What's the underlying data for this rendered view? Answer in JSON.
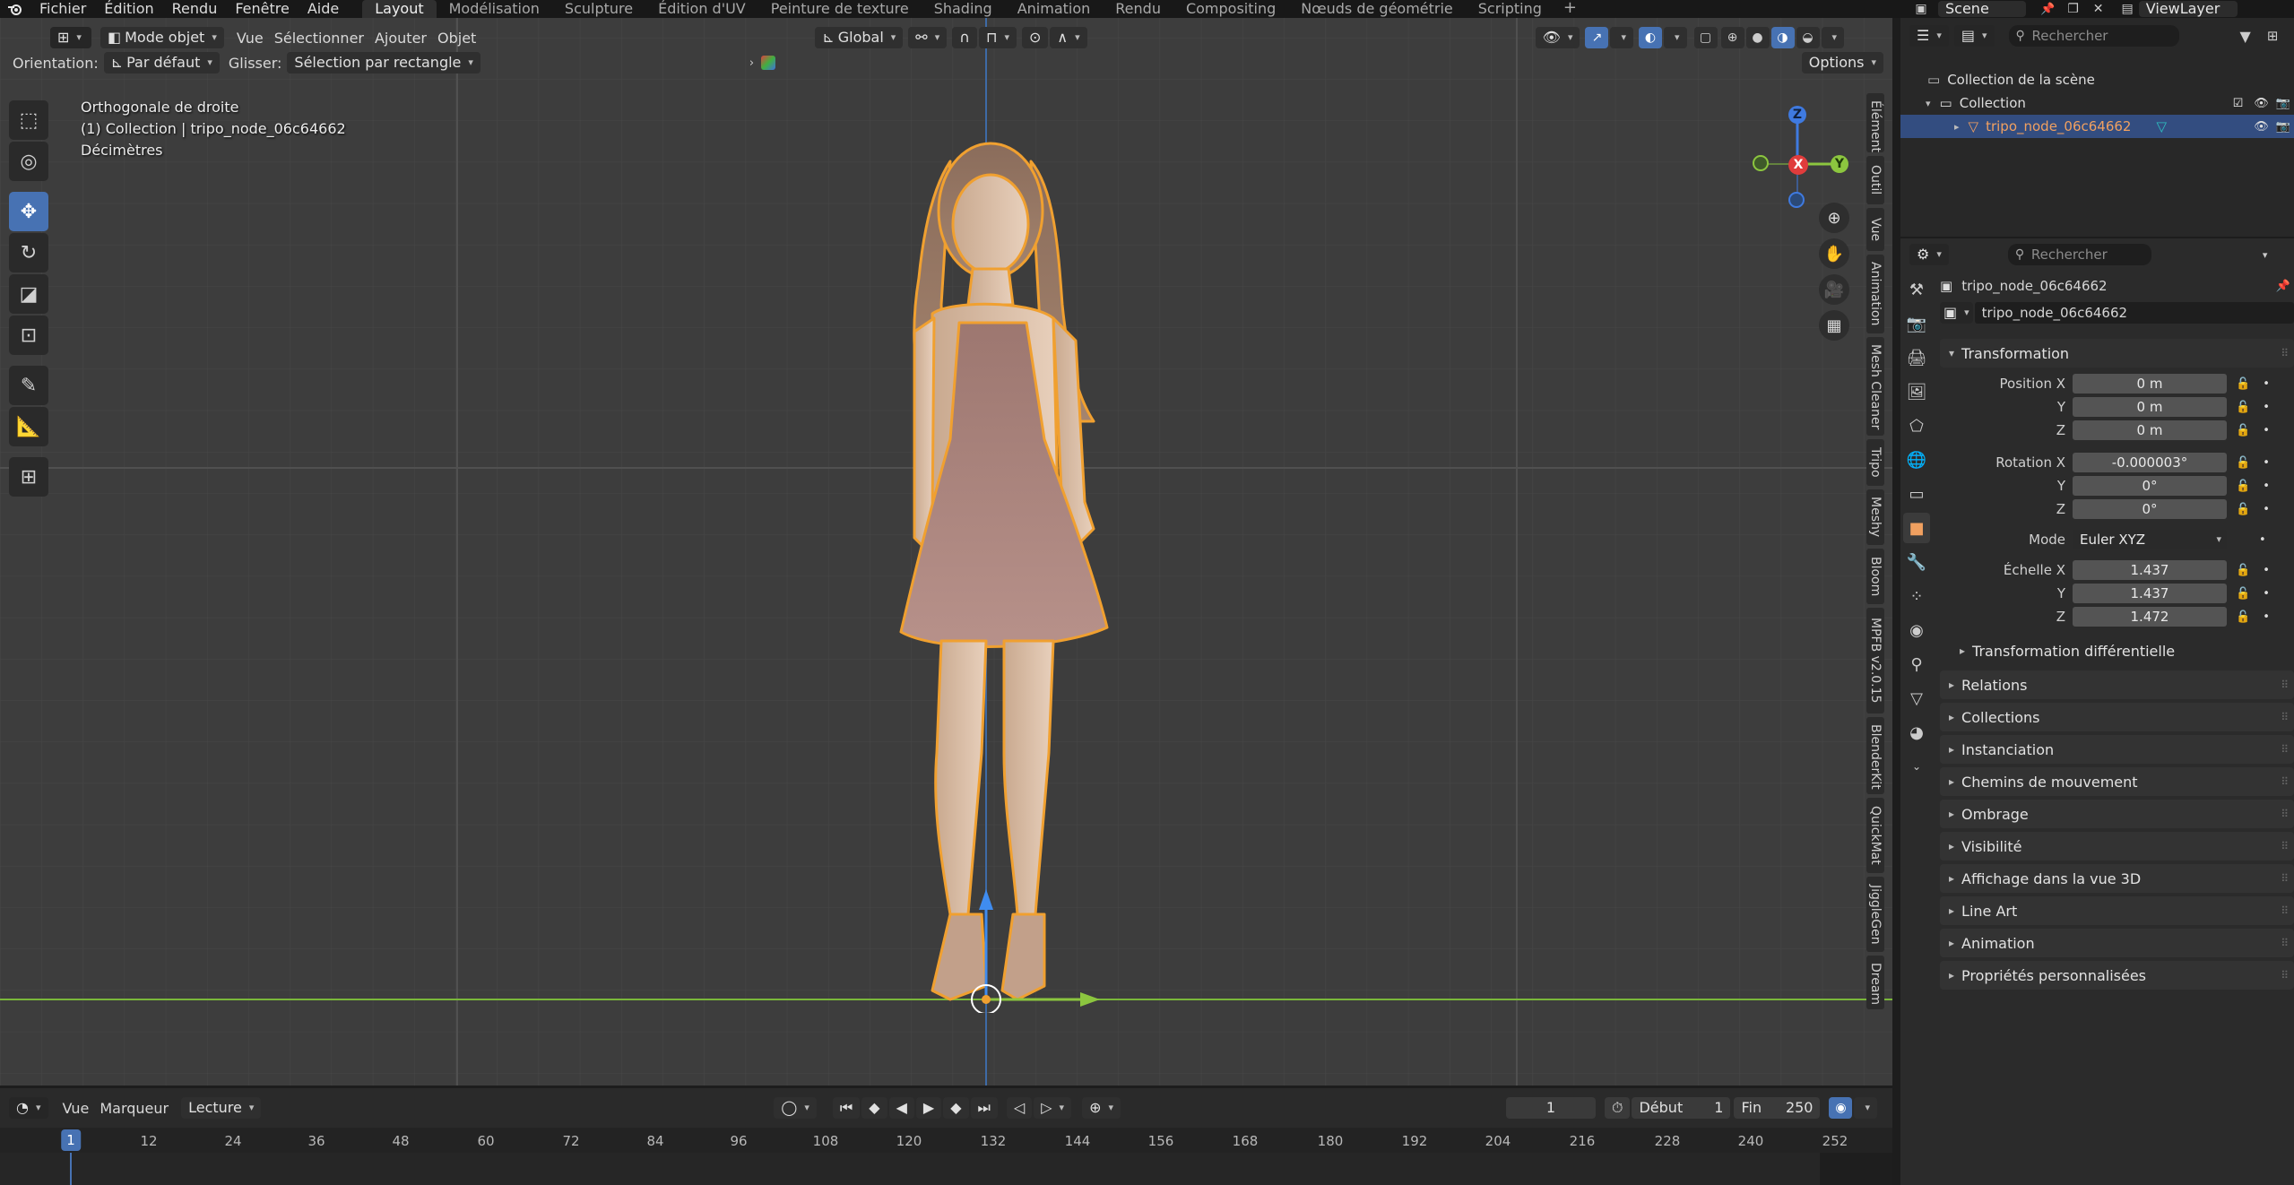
{
  "topbar": {
    "menus": [
      "Fichier",
      "Édition",
      "Rendu",
      "Fenêtre",
      "Aide"
    ],
    "workspaces": [
      "Layout",
      "Modélisation",
      "Sculpture",
      "Édition d'UV",
      "Peinture de texture",
      "Shading",
      "Animation",
      "Rendu",
      "Compositing",
      "Nœuds de géométrie",
      "Scripting"
    ],
    "active_workspace": "Layout",
    "scene": "Scene",
    "view_layer": "ViewLayer"
  },
  "viewport_header": {
    "mode": "Mode objet",
    "menus": [
      "Vue",
      "Sélectionner",
      "Ajouter",
      "Objet"
    ],
    "transform_orientation": "Global",
    "orientation_label": "Orientation:",
    "orientation_value": "Par défaut",
    "drag_label": "Glisser:",
    "drag_value": "Sélection par rectangle",
    "options": "Options"
  },
  "viewport_overlay": {
    "view_name": "Orthogonale de droite",
    "collection_line": "(1) Collection | tripo_node_06c64662",
    "units": "Décimètres"
  },
  "gizmo": {
    "z": "Z",
    "x": "X",
    "y": "Y"
  },
  "side_tabs": [
    "Élément",
    "Outil",
    "Vue",
    "Animation",
    "Mesh Cleaner",
    "Tripo",
    "Meshy",
    "Bloom",
    "MPFB v2.0.15",
    "BlenderKit",
    "QuickMat",
    "JiggleGen",
    "Dream"
  ],
  "timeline": {
    "menus": [
      "Vue",
      "Marqueur"
    ],
    "playback": "Lecture",
    "current_frame": "1",
    "start_label": "Début",
    "start": "1",
    "end_label": "Fin",
    "end": "250",
    "ticks": [
      "12",
      "24",
      "36",
      "48",
      "60",
      "72",
      "84",
      "96",
      "108",
      "120",
      "132",
      "144",
      "156",
      "168",
      "180",
      "192",
      "204",
      "216",
      "228",
      "240",
      "252"
    ],
    "playhead": "1"
  },
  "outliner": {
    "search_placeholder": "Rechercher",
    "scene_collection": "Collection de la scène",
    "collection": "Collection",
    "object": "tripo_node_06c64662"
  },
  "properties": {
    "search_placeholder": "Rechercher",
    "object_title": "tripo_node_06c64662",
    "object_name_field": "tripo_node_06c64662",
    "transform_title": "Transformation",
    "position_label": "Position X",
    "position": [
      "0 m",
      "0 m",
      "0 m"
    ],
    "rotation_label": "Rotation X",
    "rotation": [
      "-0.000003°",
      "0°",
      "0°"
    ],
    "mode_label": "Mode",
    "mode_value": "Euler XYZ",
    "scale_label": "Échelle X",
    "scale": [
      "1.437",
      "1.437",
      "1.472"
    ],
    "axis_y": "Y",
    "axis_z": "Z",
    "delta_transform": "Transformation différentielle",
    "panels": [
      "Relations",
      "Collections",
      "Instanciation",
      "Chemins de mouvement",
      "Ombrage",
      "Visibilité",
      "Affichage dans la vue 3D",
      "Line Art",
      "Animation",
      "Propriétés personnalisées"
    ]
  },
  "colors": {
    "accent": "#4772b3",
    "selection_outline": "#f0a030",
    "floor_line": "#8cc63f",
    "viewport_bg": "#3d3d3d"
  }
}
